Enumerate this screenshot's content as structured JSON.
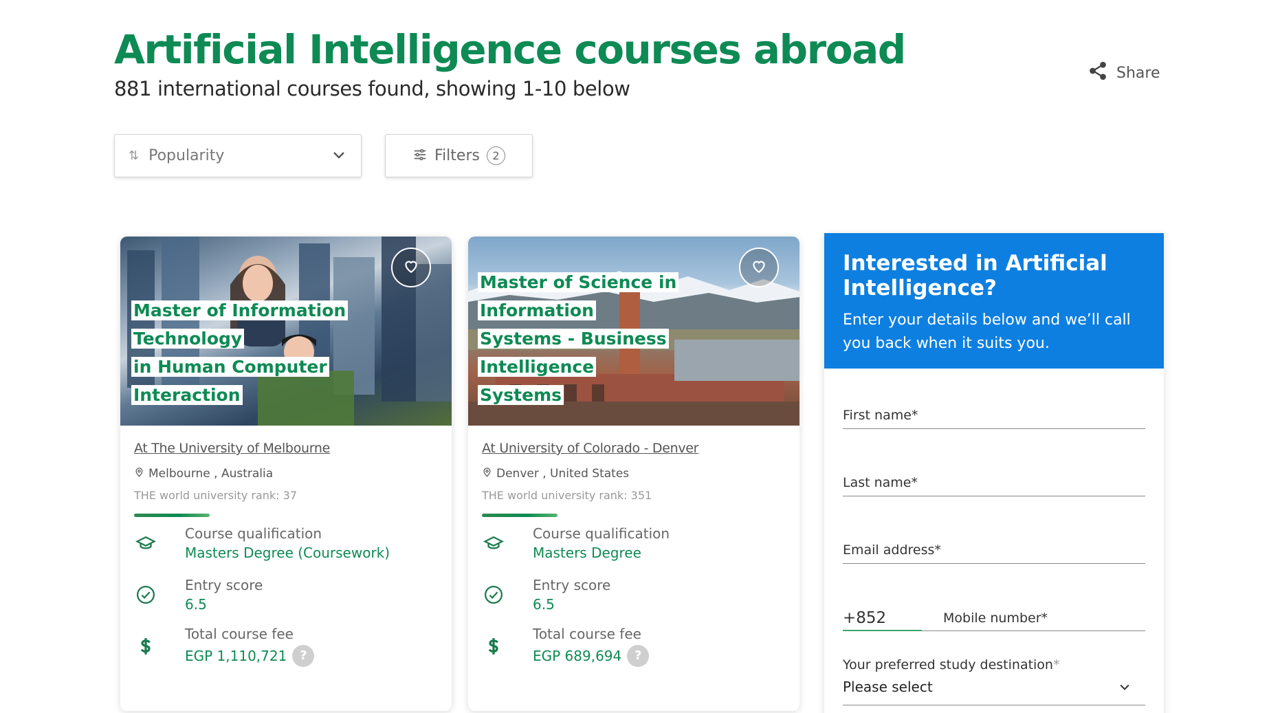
{
  "header": {
    "title": "Artificial Intelligence courses abroad",
    "subtitle": "881 international courses found, showing 1-10 below",
    "share_label": "Share"
  },
  "toolbar": {
    "sort_value": "Popularity",
    "filters_label": "Filters",
    "filters_count": "2"
  },
  "courses": [
    {
      "title_lines": [
        "Master of Information Technology",
        "in Human Computer Interaction"
      ],
      "university": "At The University of Melbourne",
      "location": "Melbourne , Australia",
      "rank_label": "THE world university rank:",
      "rank_value": "37",
      "qualification_label": "Course qualification",
      "qualification_value": "Masters Degree (Coursework)",
      "entry_label": "Entry score",
      "entry_value": "6.5",
      "fee_label": "Total course fee",
      "fee_value": "EGP 1,110,721",
      "help_symbol": "?"
    },
    {
      "title_lines": [
        "Master of Science in Information",
        "Systems - Business Intelligence",
        "Systems"
      ],
      "university": "At University of Colorado - Denver",
      "location": "Denver , United States",
      "rank_label": "THE world university rank:",
      "rank_value": "351",
      "qualification_label": "Course qualification",
      "qualification_value": "Masters Degree",
      "entry_label": "Entry score",
      "entry_value": "6.5",
      "fee_label": "Total course fee",
      "fee_value": "EGP 689,694",
      "help_symbol": "?"
    }
  ],
  "lead_form": {
    "title": "Interested in Artificial Intelligence?",
    "description": "Enter your details below and we’ll call you back when it suits you.",
    "first_name_label": "First name*",
    "last_name_label": "Last name*",
    "email_label": "Email address*",
    "phone_code": "+852",
    "mobile_label": "Mobile number*",
    "destination_label": "Your preferred study destination",
    "destination_asterisk": "*",
    "destination_value": "Please select"
  },
  "colors": {
    "brand_green": "#0e8a54",
    "lead_blue": "#0d7fe0"
  },
  "icons": [
    "share-icon",
    "sort-icon",
    "chevron-down-icon",
    "sliders-icon",
    "heart-icon",
    "map-pin-icon",
    "graduation-cap-icon",
    "check-circle-icon",
    "dollar-icon"
  ]
}
